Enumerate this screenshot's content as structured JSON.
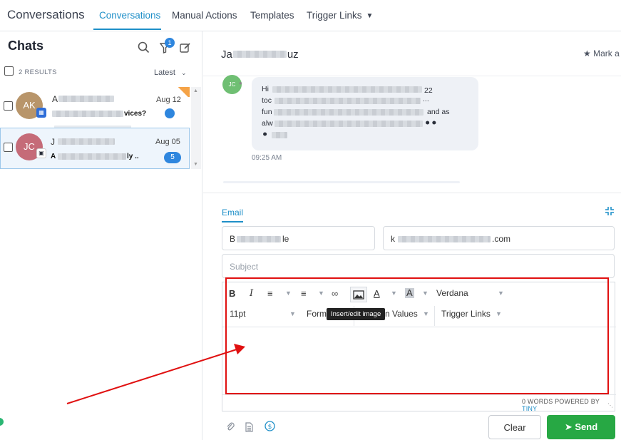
{
  "nav": {
    "brand": "Conversations",
    "tabs": [
      "Conversations",
      "Manual Actions",
      "Templates",
      "Trigger Links"
    ]
  },
  "sidebar": {
    "title": "Chats",
    "filter_badge": "1",
    "results": "2 RESULTS",
    "sort": "Latest",
    "chats": [
      {
        "initials": "AK",
        "name_start": "A",
        "date": "Aug 12",
        "preview_end": "vices?",
        "avatar_color": "#b8956a"
      },
      {
        "initials": "JC",
        "name_start": "J",
        "date": "Aug 05",
        "preview_start": "A",
        "preview_end": "ly ..",
        "unread": "5",
        "avatar_color": "#c56b78"
      }
    ]
  },
  "conversation": {
    "contact_name_start": "Ja",
    "contact_name_end": "uz",
    "mark_label": "Mark a",
    "msg_avatar": "JC",
    "message_fragments": [
      "Hi",
      "22",
      "toc",
      "...",
      "fun",
      "and as",
      "alw"
    ],
    "time": "09:25 AM"
  },
  "composer": {
    "channel_tab": "Email",
    "from_start": "B",
    "from_end": "le",
    "to_start": "k",
    "to_end": ".com",
    "subject_placeholder": "Subject",
    "font_family": "Verdana",
    "font_size": "11pt",
    "formats_label": "Form",
    "values_label": "n Values",
    "trigger_links": "Trigger Links",
    "tooltip": "Insert/edit image",
    "word_count": "0 WORDS POWERED BY",
    "tiny": "TINY",
    "clear": "Clear",
    "send": "Send"
  },
  "colors": {
    "accent": "#1e8fc8",
    "send": "#27a844",
    "highlight": "#e01010"
  }
}
